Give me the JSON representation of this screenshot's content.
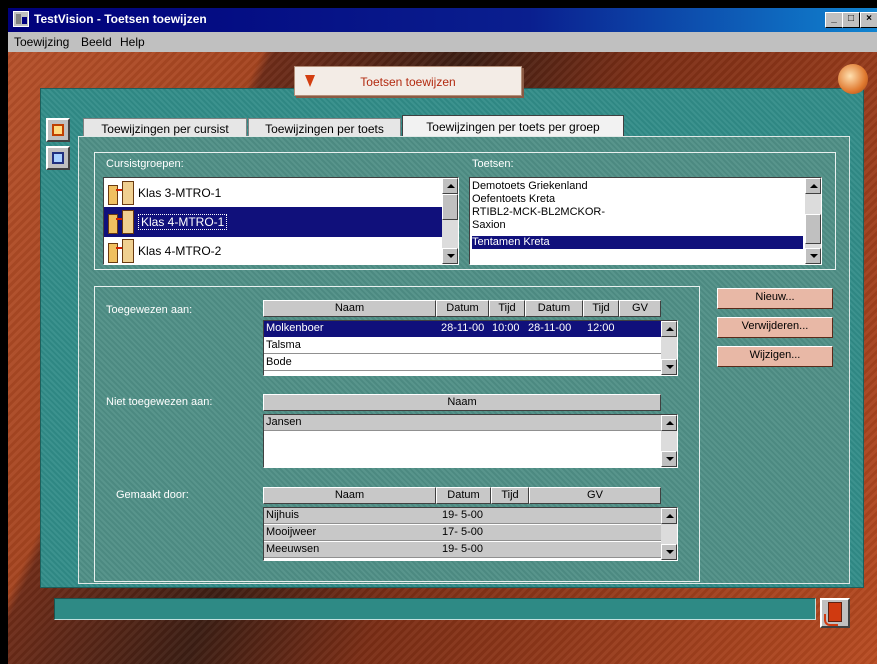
{
  "window": {
    "title": "TestVision - Toetsen toewijzen",
    "controls": [
      "_",
      "□",
      "×"
    ]
  },
  "menubar": {
    "items": [
      "Toewijzing",
      "Beeld",
      "Help"
    ]
  },
  "caption": {
    "label": "Toetsen toewijzen"
  },
  "tabs": [
    {
      "label": "Toewijzingen per cursist"
    },
    {
      "label": "Toewijzingen per toets"
    },
    {
      "label": "Toewijzingen per toets per groep",
      "active": true
    }
  ],
  "groups": {
    "label": "Cursistgroepen:",
    "items": [
      {
        "label": "Klas 3-MTRO-1",
        "selected": false
      },
      {
        "label": "Klas 4-MTRO-1",
        "selected": true
      },
      {
        "label": "Klas 4-MTRO-2",
        "selected": false
      }
    ]
  },
  "tests": {
    "label": "Toetsen:",
    "items": [
      {
        "label": "Demotoets Griekenland",
        "selected": false
      },
      {
        "label": "Oefentoets Kreta",
        "selected": false
      },
      {
        "label": "RTIBL2-MCK-BL2MCKOR-",
        "selected": false
      },
      {
        "label": "Saxion",
        "selected": false
      },
      {
        "label": "Tentamen Kreta",
        "selected": true
      }
    ]
  },
  "assigned": {
    "label": "Toegewezen aan:",
    "headers": [
      "Naam",
      "Datum",
      "Tijd",
      "Datum",
      "Tijd",
      "GV"
    ],
    "rows": [
      {
        "naam": "Molkenboer",
        "datum1": "28-11-00",
        "tijd1": "10:00",
        "datum2": "28-11-00",
        "tijd2": "12:00",
        "selected": true
      },
      {
        "naam": "Talsma",
        "datum1": "",
        "tijd1": "",
        "datum2": "",
        "tijd2": "",
        "selected": false
      },
      {
        "naam": "Bode",
        "datum1": "",
        "tijd1": "",
        "datum2": "",
        "tijd2": "",
        "selected": false
      }
    ]
  },
  "not_assigned": {
    "label": "Niet toegewezen aan:",
    "headers": [
      "Naam"
    ],
    "rows": [
      {
        "naam": "Jansen"
      }
    ]
  },
  "made_by": {
    "label": "Gemaakt door:",
    "headers": [
      "Naam",
      "Datum",
      "Tijd",
      "GV"
    ],
    "rows": [
      {
        "naam": "Nijhuis",
        "datum": "19- 5-00"
      },
      {
        "naam": "Mooijweer",
        "datum": "17- 5-00"
      },
      {
        "naam": "Meeuwsen",
        "datum": "19- 5-00"
      }
    ]
  },
  "buttons": {
    "new": "Nieuw...",
    "delete": "Verwijderen...",
    "edit": "Wijzigen..."
  },
  "colors": {
    "selection": "#10107b",
    "panel": "#318c88",
    "button": "#e8b8a6",
    "caption_text": "#b22a10"
  }
}
